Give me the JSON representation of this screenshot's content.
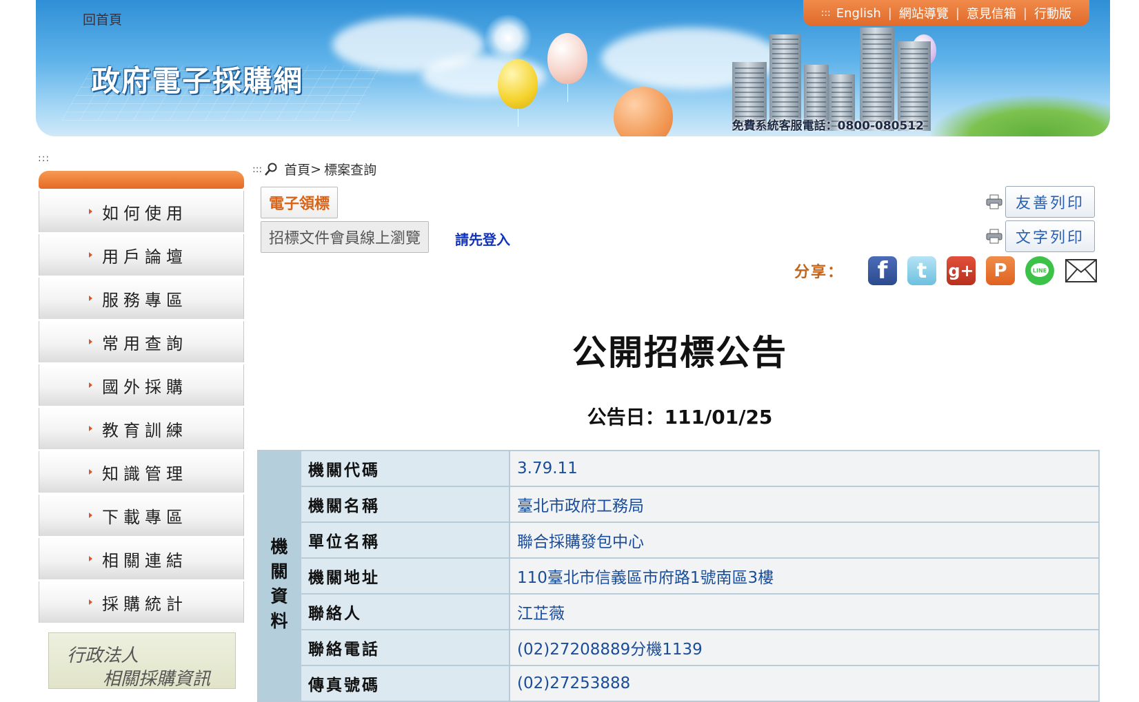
{
  "header": {
    "home_link": "回首頁",
    "site_title": "政府電子採購網",
    "hotline": "免費系統客服電話：0800-080512",
    "topnav": {
      "prefix": ":::",
      "items": [
        "English",
        "網站導覽",
        "意見信箱",
        "行動版"
      ]
    }
  },
  "sidebar": {
    "marker": ":::",
    "items": [
      "如何使用",
      "用戶論壇",
      "服務專區",
      "常用查詢",
      "國外採購",
      "教育訓練",
      "知識管理",
      "下載專區",
      "相關連結",
      "採購統計"
    ],
    "legal_box": {
      "line1": "行政法人",
      "line2": "相關採購資訊"
    }
  },
  "breadcrumb": {
    "marker": ":::",
    "home": "首頁",
    "sep": ">",
    "current": "標案查詢"
  },
  "actions": {
    "etender": "電子領標",
    "members_browse": "招標文件會員線上瀏覽",
    "login_prompt": "請先登入",
    "friendly_print": "友善列印",
    "text_print": "文字列印",
    "share_label": "分享："
  },
  "share_icons": [
    "facebook-icon",
    "twitter-icon",
    "google-plus-icon",
    "plurk-icon",
    "line-icon",
    "mail-icon"
  ],
  "announcement": {
    "title": "公開招標公告",
    "date_label": "公告日：",
    "date_value": "111/01/25"
  },
  "agency_info": {
    "group_label": [
      "機",
      "關",
      "資",
      "料"
    ],
    "rows": [
      {
        "key": "機關代碼",
        "value": "3.79.11"
      },
      {
        "key": "機關名稱",
        "value": "臺北市政府工務局"
      },
      {
        "key": "單位名稱",
        "value": "聯合採購發包中心"
      },
      {
        "key": "機關地址",
        "value": "110臺北市信義區市府路1號南區3樓"
      },
      {
        "key": "聯絡人",
        "value": "江芷薇"
      },
      {
        "key": "聯絡電話",
        "value": "(02)27208889分機1139"
      },
      {
        "key": "傳真號碼",
        "value": "(02)27253888"
      }
    ]
  },
  "colors": {
    "orange_accent": "#e56a22",
    "link_blue": "#1a4d99",
    "table_header": "#b5cedc"
  }
}
